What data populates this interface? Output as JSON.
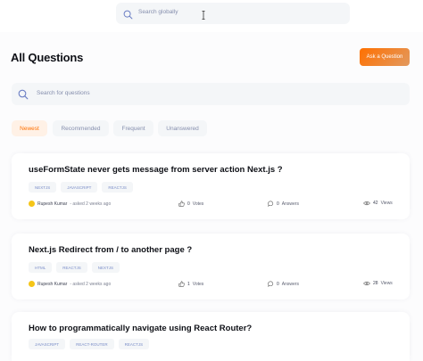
{
  "global_search": {
    "placeholder": "Search globally"
  },
  "page": {
    "title": "All Questions",
    "ask_button": "Ask a Question"
  },
  "local_search": {
    "placeholder": "Search for questions"
  },
  "filters": [
    "Newest",
    "Recommended",
    "Frequent",
    "Unanswered"
  ],
  "active_filter": "Newest",
  "colors": {
    "accent": "#ff7000",
    "tag_text": "#7b8ec8",
    "background": "#fcfcfd"
  },
  "questions": [
    {
      "title": "useFormState never gets message from server action Next.js ?",
      "tags": [
        "NEXTJS",
        "JAVASCRIPT",
        "REACTJS"
      ],
      "author": "Rupesh Kumar",
      "asked": "- asked 2 weeks ago",
      "votes": "0",
      "votes_label": "Votes",
      "answers": "0",
      "answers_label": "Answers",
      "views": "42",
      "views_label": "Views"
    },
    {
      "title": "Next.js Redirect from / to another page ?",
      "tags": [
        "HTML",
        "REACTJS",
        "NEXTJS"
      ],
      "author": "Rupesh Kumar",
      "asked": "- asked 2 weeks ago",
      "votes": "1",
      "votes_label": "Votes",
      "answers": "0",
      "answers_label": "Answers",
      "views": "28",
      "views_label": "Views"
    },
    {
      "title": "How to programmatically navigate using React Router?",
      "tags": [
        "JAVASCRIPT",
        "REACT-ROUTER",
        "REACTJS"
      ]
    }
  ],
  "icons": {
    "search": "search-icon",
    "like": "thumbs-up-icon",
    "answers": "message-icon",
    "views": "eye-icon",
    "cursor": "text-cursor-icon"
  }
}
